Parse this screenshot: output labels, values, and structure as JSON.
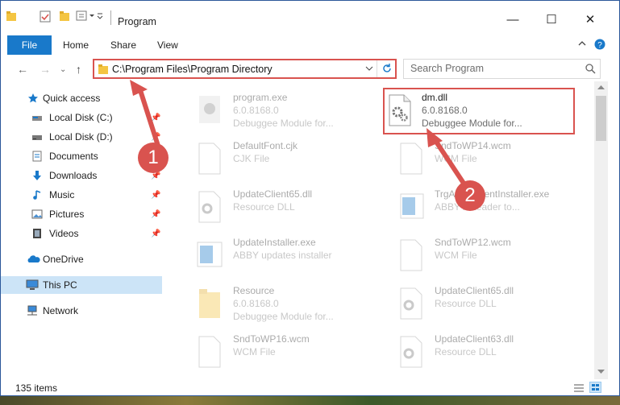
{
  "window": {
    "title": "Program",
    "controls": {
      "minimize": "—",
      "maximize": "☐",
      "close": "✕"
    }
  },
  "ribbon": {
    "tabs": [
      "File",
      "Home",
      "Share",
      "View"
    ]
  },
  "address": {
    "path": "C:\\Program Files\\Program Directory",
    "search_placeholder": "Search Program"
  },
  "nav_pane": {
    "items": [
      {
        "label": "Quick access",
        "icon": "star-icon"
      },
      {
        "label": "Local Disk (C:)",
        "icon": "drive-icon",
        "pinned": true
      },
      {
        "label": "Local Disk (D:)",
        "icon": "drive-icon",
        "pinned": true
      },
      {
        "label": "Documents",
        "icon": "documents-icon",
        "pinned": true
      },
      {
        "label": "Downloads",
        "icon": "downloads-icon",
        "pinned": true
      },
      {
        "label": "Music",
        "icon": "music-icon",
        "pinned": true
      },
      {
        "label": "Pictures",
        "icon": "pictures-icon",
        "pinned": true
      },
      {
        "label": "Videos",
        "icon": "videos-icon",
        "pinned": true
      },
      {
        "label": "OneDrive",
        "icon": "onedrive-icon"
      },
      {
        "label": "This PC",
        "icon": "pc-icon",
        "selected": true
      },
      {
        "label": "Network",
        "icon": "network-icon"
      }
    ]
  },
  "files": [
    {
      "name": "program.exe",
      "line2": "6.0.8168.0",
      "line3": "Debuggee Module for...",
      "icon": "exe-icon",
      "faded": true
    },
    {
      "name": "dm.dll",
      "line2": "6.0.8168.0",
      "line3": "Debuggee Module for...",
      "icon": "dll-icon",
      "faded": false
    },
    {
      "name": "DefaultFont.cjk",
      "line2": "CJK File",
      "icon": "file-icon",
      "faded": true
    },
    {
      "name": "SndToWP14.wcm",
      "line2": "WCM File",
      "icon": "file-icon",
      "faded": true
    },
    {
      "name": "UpdateClient65.dll",
      "line2": "Resource DLL",
      "icon": "dll-icon",
      "faded": true
    },
    {
      "name": "TrgAttachmentInstaller.exe",
      "line2": "ABBYY Reader to...",
      "icon": "exe-icon",
      "faded": true
    },
    {
      "name": "UpdateInstaller.exe",
      "line2": "ABBY updates installer",
      "icon": "exe-icon",
      "faded": true
    },
    {
      "name": "SndToWP12.wcm",
      "line2": "WCM File",
      "icon": "file-icon",
      "faded": true
    },
    {
      "name": "Resource",
      "line2": "6.0.8168.0",
      "line3": "Debuggee Module for...",
      "icon": "folder-icon",
      "faded": true
    },
    {
      "name": "UpdateClient65.dll",
      "line2": "Resource DLL",
      "icon": "dll-icon",
      "faded": true
    },
    {
      "name": "SndToWP16.wcm",
      "line2": "WCM File",
      "icon": "file-icon",
      "faded": true
    },
    {
      "name": "UpdateClient63.dll",
      "line2": "Resource DLL",
      "icon": "dll-icon",
      "faded": true
    }
  ],
  "status": {
    "item_count": "135 items"
  },
  "callouts": [
    "1",
    "2"
  ],
  "colors": {
    "accent": "#1979ca",
    "highlight": "#d9534f",
    "selection": "#cce4f7"
  }
}
